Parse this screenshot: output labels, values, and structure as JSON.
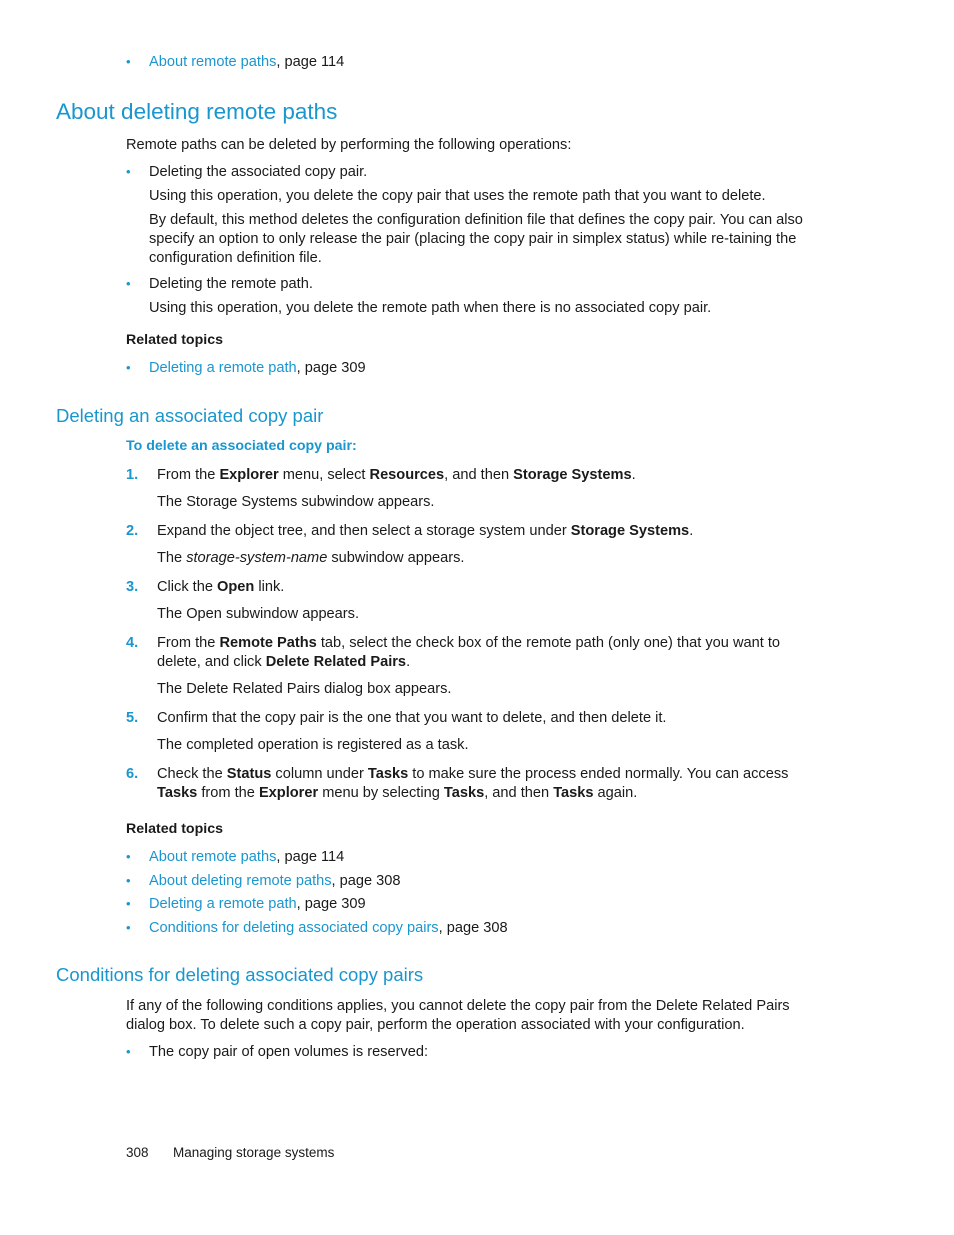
{
  "top_related": [
    {
      "link": "About remote paths",
      "suffix": ", page 114"
    }
  ],
  "section1": {
    "title": "About deleting remote paths",
    "intro": "Remote paths can be deleted by performing the following operations:",
    "bullets": [
      {
        "label": "Deleting the associated copy pair.",
        "paras": [
          "Using this operation, you delete the copy pair that uses the remote path that you want to delete.",
          "By default, this method deletes the configuration definition file that defines the copy pair. You can also specify an option to only release the pair (placing the copy pair in simplex status) while re-taining the configuration definition file."
        ]
      },
      {
        "label": "Deleting the remote path.",
        "paras": [
          "Using this operation, you delete the remote path when there is no associated copy pair."
        ]
      }
    ],
    "related_heading": "Related topics",
    "related": [
      {
        "link": "Deleting a remote path",
        "suffix": ", page 309"
      }
    ]
  },
  "section2": {
    "title": "Deleting an associated copy pair",
    "procedure_heading": "To delete an associated copy pair:",
    "steps": [
      {
        "num": "1.",
        "parts": [
          {
            "t": "From the "
          },
          {
            "b": "Explorer"
          },
          {
            "t": " menu, select "
          },
          {
            "b": "Resources"
          },
          {
            "t": ", and then "
          },
          {
            "b": "Storage Systems"
          },
          {
            "t": "."
          }
        ],
        "result_parts": [
          {
            "t": "The Storage Systems subwindow appears."
          }
        ]
      },
      {
        "num": "2.",
        "parts": [
          {
            "t": "Expand the object tree, and then select a storage system under "
          },
          {
            "b": "Storage Systems"
          },
          {
            "t": "."
          }
        ],
        "result_parts": [
          {
            "t": "The "
          },
          {
            "i": "storage-system-name"
          },
          {
            "t": " subwindow appears."
          }
        ]
      },
      {
        "num": "3.",
        "parts": [
          {
            "t": "Click the "
          },
          {
            "b": "Open"
          },
          {
            "t": " link."
          }
        ],
        "result_parts": [
          {
            "t": "The Open subwindow appears."
          }
        ]
      },
      {
        "num": "4.",
        "parts": [
          {
            "t": "From the "
          },
          {
            "b": "Remote Paths"
          },
          {
            "t": " tab, select the check box of the remote path (only one) that you want to delete, and click "
          },
          {
            "b": "Delete Related Pairs"
          },
          {
            "t": "."
          }
        ],
        "result_parts": [
          {
            "t": "The Delete Related Pairs dialog box appears."
          }
        ]
      },
      {
        "num": "5.",
        "parts": [
          {
            "t": "Confirm that the copy pair is the one that you want to delete, and then delete it."
          }
        ],
        "result_parts": [
          {
            "t": "The completed operation is registered as a task."
          }
        ]
      },
      {
        "num": "6.",
        "parts": [
          {
            "t": "Check the "
          },
          {
            "b": "Status"
          },
          {
            "t": " column under "
          },
          {
            "b": "Tasks"
          },
          {
            "t": " to make sure the process ended normally. You can access "
          },
          {
            "b": "Tasks"
          },
          {
            "t": " from the "
          },
          {
            "b": "Explorer"
          },
          {
            "t": " menu by selecting "
          },
          {
            "b": "Tasks"
          },
          {
            "t": ", and then "
          },
          {
            "b": "Tasks"
          },
          {
            "t": " again."
          }
        ],
        "result_parts": []
      }
    ],
    "related_heading": "Related topics",
    "related": [
      {
        "link": "About remote paths",
        "suffix": ", page 114"
      },
      {
        "link": "About deleting remote paths",
        "suffix": ", page 308"
      },
      {
        "link": "Deleting a remote path",
        "suffix": ", page 309"
      },
      {
        "link": "Conditions for deleting associated copy pairs",
        "suffix": ", page 308"
      }
    ]
  },
  "section3": {
    "title": "Conditions for deleting associated copy pairs",
    "intro": "If any of the following conditions applies, you cannot delete the copy pair from the Delete Related Pairs dialog box. To delete such a copy pair, perform the operation associated with your configuration.",
    "bullets": [
      "The copy pair of open volumes is reserved:"
    ]
  },
  "footer": {
    "page_number": "308",
    "chapter": "Managing storage systems"
  },
  "bullet_glyph": "•"
}
